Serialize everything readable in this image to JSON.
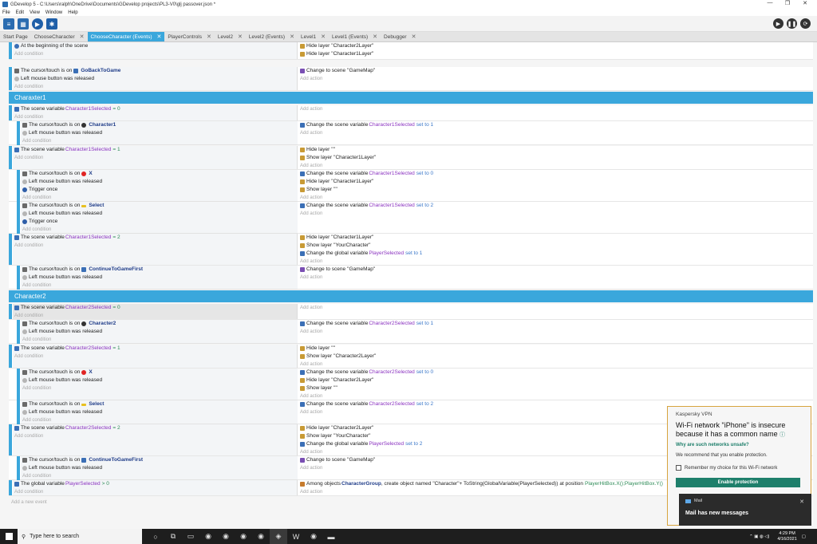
{
  "window": {
    "title": "GDevelop 5 - C:\\Users\\ralph\\OneDrive\\Documents\\GDevelop projects\\PL3-V0\\glj passover.json *",
    "controls": [
      "—",
      "❐",
      "✕"
    ]
  },
  "menu": [
    "File",
    "Edit",
    "View",
    "Window",
    "Help"
  ],
  "tabs": [
    {
      "label": "Start Page"
    },
    {
      "label": "ChooseCharacter"
    },
    {
      "label": "ChooseCharacter (Events)"
    },
    {
      "label": "PlayerControls"
    },
    {
      "label": "Level2"
    },
    {
      "label": "Level2 (Events)"
    },
    {
      "label": "Level1"
    },
    {
      "label": "Level1 (Events)"
    },
    {
      "label": "Debugger"
    }
  ],
  "editor": {
    "add_condition": "Add condition",
    "add_action": "Add action",
    "add_event": "Add a new event",
    "e1": {
      "c1": "At the beginning of the scene",
      "a1": "Hide layer",
      "a1v": "\"Character2Layer\"",
      "a2": "Hide layer",
      "a2v": "\"Character1Layer\""
    },
    "e2": {
      "c1": "The cursor/touch is on",
      "c1o": "GoBackToGame",
      "c2": "Left mouse button was released",
      "a1": "Change to scene",
      "a1v": "\"GameMap\""
    },
    "group1": "Charaxter1",
    "g1e1": {
      "c1": "The scene variable",
      "c1o": "Character1Selected",
      "c1v": "= 0",
      "s1": {
        "c1": "The cursor/touch is on",
        "c1o": "Character1",
        "c2": "Left mouse button was released",
        "a1": "Change the scene variable",
        "a1o": "Character1Selected",
        "a1v": "set to 1"
      }
    },
    "g1e2": {
      "c1": "The scene variable",
      "c1o": "Character1Selected",
      "c1v": "= 1",
      "a1": "Hide layer",
      "a1v": "\"\"",
      "a2": "Show layer",
      "a2v": "\"Character1Layer\"",
      "s1": {
        "c1": "The cursor/touch is on",
        "c1o": "X",
        "c2": "Left mouse button was released",
        "c3": "Trigger once",
        "a1": "Change the scene variable",
        "a1o": "Character1Selected",
        "a1v": "set to 0",
        "a2": "Hide layer",
        "a2v": "\"Character1Layer\"",
        "a3": "Show layer",
        "a3v": "\"\""
      },
      "s2": {
        "c1": "The cursor/touch is on",
        "c1o": "Select",
        "c2": "Left mouse button was released",
        "c3": "Trigger once",
        "a1": "Change the scene variable",
        "a1o": "Character1Selected",
        "a1v": "set to 2"
      }
    },
    "g1e3": {
      "c1": "The scene variable",
      "c1o": "Character1Selected",
      "c1v": "= 2",
      "a1": "Hide layer",
      "a1v": "\"Character1Layer\"",
      "a2": "Show layer",
      "a2v": "\"YourCharacter\"",
      "a3": "Change the global variable",
      "a3o": "PlayerSelected",
      "a3v": "set to 1",
      "s1": {
        "c1": "The cursor/touch is on",
        "c1o": "ContinueToGameFirst",
        "c2": "Left mouse button was released",
        "a1": "Change to scene",
        "a1v": "\"GameMap\""
      }
    },
    "group2": "Character2",
    "g2e1": {
      "c1": "The scene variable",
      "c1o": "Character2Selected",
      "c1v": "= 0",
      "s1": {
        "c1": "The cursor/touch is on",
        "c1o": "Character2",
        "c2": "Left mouse button was released",
        "a1": "Change the scene variable",
        "a1o": "Character2Selected",
        "a1v": "set to 1"
      }
    },
    "g2e2": {
      "c1": "The scene variable",
      "c1o": "Character2Selected",
      "c1v": "= 1",
      "a1": "Hide layer",
      "a1v": "\"\"",
      "a2": "Show layer",
      "a2v": "\"Character2Layer\"",
      "s1": {
        "c1": "The cursor/touch is on",
        "c1o": "X",
        "c2": "Left mouse button was released",
        "a1": "Change the scene variable",
        "a1o": "Character2Selected",
        "a1v": "set to 0",
        "a2": "Hide layer",
        "a2v": "\"Character2Layer\"",
        "a3": "Show layer",
        "a3v": "\"\""
      },
      "s2": {
        "c1": "The cursor/touch is on",
        "c1o": "Select",
        "c2": "Left mouse button was released",
        "a1": "Change the scene variable",
        "a1o": "Character2Selected",
        "a1v": "set to 2"
      }
    },
    "g2e3": {
      "c1": "The scene variable",
      "c1o": "Character2Selected",
      "c1v": "= 2",
      "a1": "Hide layer",
      "a1v": "\"Character2Layer\"",
      "a2": "Show layer",
      "a2v": "\"YourCharacter\"",
      "a3": "Change the global variable",
      "a3o": "PlayerSelected",
      "a3v": "set to 2",
      "s1": {
        "c1": "The cursor/touch is on",
        "c1o": "ContinueToGameFirst",
        "c2": "Left mouse button was released",
        "a1": "Change to scene",
        "a1v": "\"GameMap\""
      }
    },
    "last": {
      "c1": "The global variable",
      "c1o": "PlayerSelected",
      "c1v": "> 0",
      "a1": "Among objects",
      "a1o": "CharacterGroup",
      "a1m": ", create object named",
      "a1s": "\"Character\"+ ToString(GlobalVariable(PlayerSelected))",
      "a1p": "at position",
      "a1x": "PlayerHitBox.X();PlayerHitBox.Y()"
    }
  },
  "vpn_popup": {
    "title": "Kaspersky VPN",
    "heading": "Wi-Fi network \"iPhone\" is insecure because it has a common name",
    "link": "Why are such networks unsafe?",
    "text": "We recommend that you enable protection.",
    "checkbox": "Remember my choice for this Wi-Fi network",
    "button": "Enable protection"
  },
  "mail_toast": {
    "app": "Mail",
    "message": "Mail has new messages"
  },
  "taskbar": {
    "search_placeholder": "Type here to search",
    "time": "4:29 PM",
    "date": "4/16/2021"
  }
}
